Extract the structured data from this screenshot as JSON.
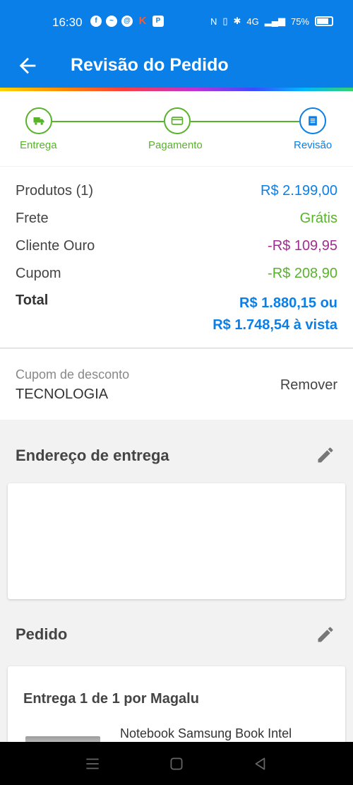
{
  "status_bar": {
    "time": "16:30",
    "battery": "75%",
    "network": "4G"
  },
  "app_bar": {
    "title": "Revisão do Pedido",
    "back_icon": "arrow-left-icon"
  },
  "stepper": {
    "steps": [
      {
        "label": "Entrega",
        "icon": "truck-icon",
        "state": "done"
      },
      {
        "label": "Pagamento",
        "icon": "credit-card-icon",
        "state": "done"
      },
      {
        "label": "Revisão",
        "icon": "receipt-icon",
        "state": "active"
      }
    ]
  },
  "summary": {
    "products_label": "Produtos (1)",
    "products_value": "R$ 2.199,00",
    "shipping_label": "Frete",
    "shipping_value": "Grátis",
    "gold_label": "Cliente Ouro",
    "gold_value": "-R$ 109,95",
    "coupon_label": "Cupom",
    "coupon_value": "-R$ 208,90",
    "total_label": "Total",
    "total_line1": "R$ 1.880,15 ou",
    "total_line2": "R$ 1.748,54 à vista"
  },
  "coupon": {
    "label": "Cupom de desconto",
    "code": "TECNOLOGIA",
    "remove_label": "Remover"
  },
  "address_section": {
    "title": "Endereço de entrega",
    "edit_icon": "pencil-icon"
  },
  "order_section": {
    "title": "Pedido",
    "edit_icon": "pencil-icon",
    "delivery_title": "Entrega 1 de 1 por Magalu",
    "product_name": "Notebook Samsung Book Intel"
  },
  "colors": {
    "primary": "#0a7fe8",
    "success": "#58b22a",
    "discount_purple": "#a02d8f"
  }
}
